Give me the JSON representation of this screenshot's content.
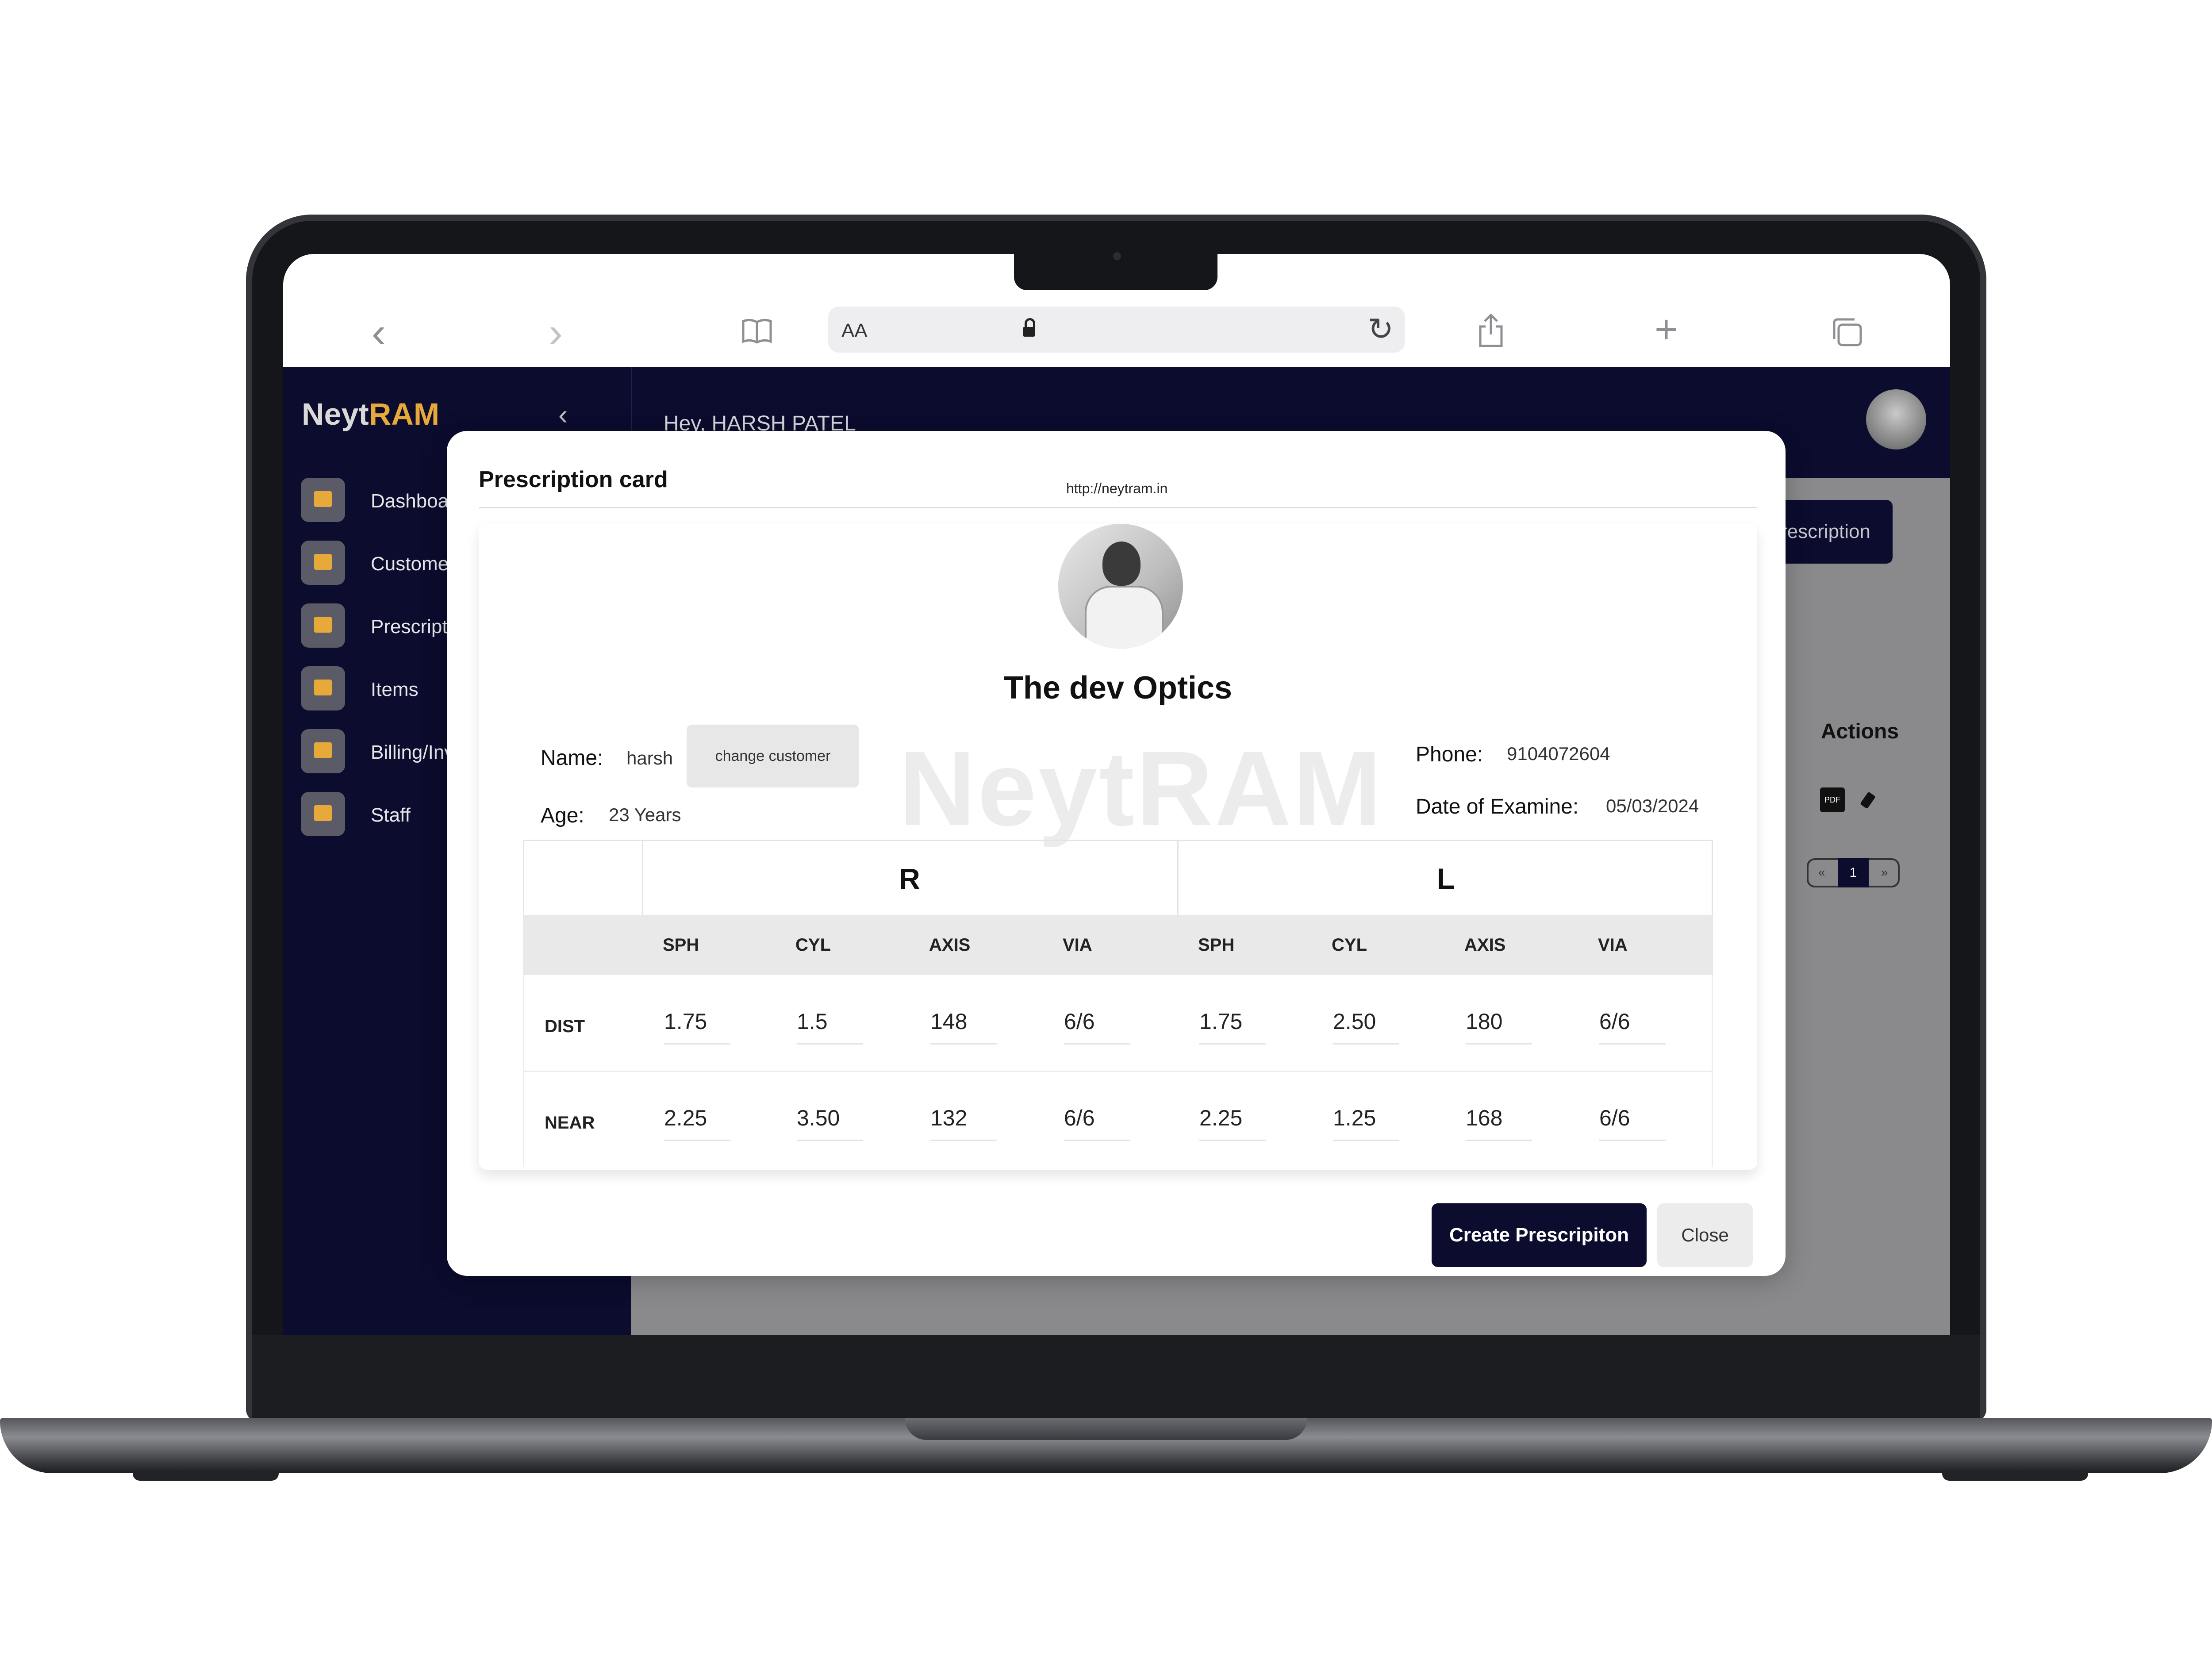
{
  "app": {
    "logo_part1": "Neyt",
    "logo_part2": "RAM",
    "greeting": "Hey, HARSH PATEL",
    "collapse_glyph": "‹"
  },
  "browser": {
    "address_aa": "AA",
    "back_glyph": "‹",
    "forward_glyph": "›",
    "reload_glyph": "↻",
    "plus_glyph": "+"
  },
  "sidebar": {
    "items": [
      {
        "label": "Dashboard",
        "icon": "home-icon"
      },
      {
        "label": "Customers",
        "icon": "home-icon"
      },
      {
        "label": "Prescription",
        "icon": "card-icon"
      },
      {
        "label": "Items",
        "icon": "card-icon"
      },
      {
        "label": "Billing/Invoice",
        "icon": "card-icon"
      },
      {
        "label": "Staff",
        "icon": "home-icon"
      }
    ]
  },
  "background": {
    "primary_button": "Prescription",
    "actions_header": "Actions",
    "pdf_label": "PDF",
    "pager": {
      "prev": "«",
      "current": "1",
      "next": "»"
    }
  },
  "modal": {
    "title": "Prescription card",
    "url": "http://neytram.in",
    "shop_name": "The dev Optics",
    "watermark": "NeytRAM",
    "patient": {
      "name_label": "Name:",
      "name_value": "harsh",
      "change_button": "change customer",
      "age_label": "Age:",
      "age_value": "23 Years",
      "phone_label": "Phone:",
      "phone_value": "9104072604",
      "date_label": "Date of Examine:",
      "date_value": "05/03/2024"
    },
    "table": {
      "right_eye": "R",
      "left_eye": "L",
      "columns": [
        "SPH",
        "CYL",
        "AXIS",
        "VIA",
        "SPH",
        "CYL",
        "AXIS",
        "VIA"
      ],
      "rows": [
        {
          "label": "DIST",
          "values": [
            "1.75",
            "1.5",
            "148",
            "6/6",
            "1.75",
            "2.50",
            "180",
            "6/6"
          ]
        },
        {
          "label": "NEAR",
          "values": [
            "2.25",
            "3.50",
            "132",
            "6/6",
            "2.25",
            "1.25",
            "168",
            "6/6"
          ]
        }
      ]
    },
    "create_button": "Create Prescripiton",
    "close_button": "Close"
  },
  "colors": {
    "navy": "#0b0c2e",
    "accent": "#e6a93a"
  }
}
